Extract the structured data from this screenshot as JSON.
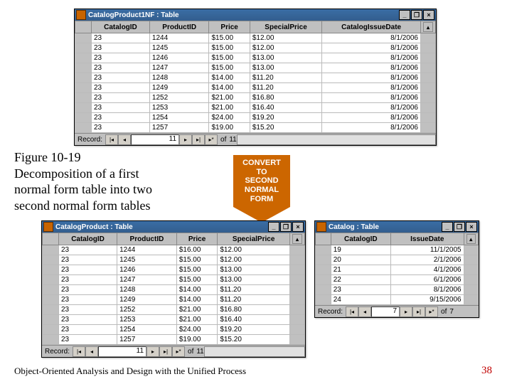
{
  "footer": {
    "left": "Object-Oriented Analysis and Design with the Unified Process",
    "page": "38"
  },
  "caption": {
    "line1": "Figure 10-19",
    "line2": "Decomposition of a first",
    "line3": "normal form table into two",
    "line4": "second normal form tables"
  },
  "arrow": {
    "line1": "CONVERT",
    "line2": "TO",
    "line3": "SECOND",
    "line4": "NORMAL",
    "line5": "FORM"
  },
  "win1": {
    "title": "CatalogProduct1NF : Table",
    "columns": [
      "CatalogID",
      "ProductID",
      "Price",
      "SpecialPrice",
      "CatalogIssueDate"
    ],
    "rows": [
      [
        "23",
        "1244",
        "$15.00",
        "$12.00",
        "8/1/2006"
      ],
      [
        "23",
        "1245",
        "$15.00",
        "$12.00",
        "8/1/2006"
      ],
      [
        "23",
        "1246",
        "$15.00",
        "$13.00",
        "8/1/2006"
      ],
      [
        "23",
        "1247",
        "$15.00",
        "$13.00",
        "8/1/2006"
      ],
      [
        "23",
        "1248",
        "$14.00",
        "$11.20",
        "8/1/2006"
      ],
      [
        "23",
        "1249",
        "$14.00",
        "$11.20",
        "8/1/2006"
      ],
      [
        "23",
        "1252",
        "$21.00",
        "$16.80",
        "8/1/2006"
      ],
      [
        "23",
        "1253",
        "$21.00",
        "$16.40",
        "8/1/2006"
      ],
      [
        "23",
        "1254",
        "$24.00",
        "$19.20",
        "8/1/2006"
      ],
      [
        "23",
        "1257",
        "$19.00",
        "$15.20",
        "8/1/2006"
      ]
    ],
    "record_label": "Record:",
    "record_no": "11",
    "of_label": "of",
    "total": "11"
  },
  "win2": {
    "title": "CatalogProduct : Table",
    "columns": [
      "CatalogID",
      "ProductID",
      "Price",
      "SpecialPrice"
    ],
    "rows": [
      [
        "23",
        "1244",
        "$16.00",
        "$12.00"
      ],
      [
        "23",
        "1245",
        "$15.00",
        "$12.00"
      ],
      [
        "23",
        "1246",
        "$15.00",
        "$13.00"
      ],
      [
        "23",
        "1247",
        "$15.00",
        "$13.00"
      ],
      [
        "23",
        "1248",
        "$14.00",
        "$11.20"
      ],
      [
        "23",
        "1249",
        "$14.00",
        "$11.20"
      ],
      [
        "23",
        "1252",
        "$21.00",
        "$16.80"
      ],
      [
        "23",
        "1253",
        "$21.00",
        "$16.40"
      ],
      [
        "23",
        "1254",
        "$24.00",
        "$19.20"
      ],
      [
        "23",
        "1257",
        "$19.00",
        "$15.20"
      ]
    ],
    "record_label": "Record:",
    "record_no": "11",
    "of_label": "of",
    "total": "11"
  },
  "win3": {
    "title": "Catalog : Table",
    "columns": [
      "CatalogID",
      "IssueDate"
    ],
    "rows": [
      [
        "19",
        "11/1/2005"
      ],
      [
        "20",
        "2/1/2006"
      ],
      [
        "21",
        "4/1/2006"
      ],
      [
        "22",
        "6/1/2006"
      ],
      [
        "23",
        "8/1/2006"
      ],
      [
        "24",
        "9/15/2006"
      ]
    ],
    "record_label": "Record:",
    "record_no": "7",
    "of_label": "of",
    "total": "7"
  }
}
